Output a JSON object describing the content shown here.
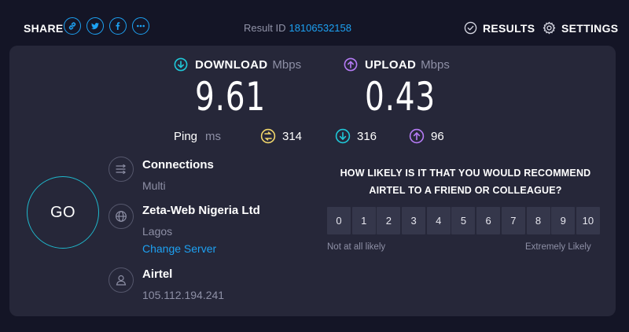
{
  "header": {
    "share_label": "SHARE",
    "share_buttons": [
      {
        "icon": "link-icon",
        "color": "#1da1f2"
      },
      {
        "icon": "twitter-icon",
        "color": "#1da1f2"
      },
      {
        "icon": "facebook-icon",
        "color": "#1da1f2"
      },
      {
        "icon": "more-icon",
        "color": "#1da1f2"
      }
    ],
    "result_id_label": "Result ID",
    "result_id": "18106532158",
    "results_label": "RESULTS",
    "settings_label": "SETTINGS"
  },
  "speeds": {
    "download": {
      "label": "DOWNLOAD",
      "unit": "Mbps",
      "value": "9.61",
      "color": "#1fc8d8"
    },
    "upload": {
      "label": "UPLOAD",
      "unit": "Mbps",
      "value": "0.43",
      "color": "#b57bf5"
    }
  },
  "ping": {
    "label": "Ping",
    "unit": "ms",
    "jitter_value": "314",
    "download_value": "316",
    "upload_value": "96"
  },
  "go_label": "GO",
  "connections": {
    "title": "Connections",
    "value": "Multi"
  },
  "server": {
    "name": "Zeta-Web Nigeria Ltd",
    "location": "Lagos",
    "change_label": "Change Server"
  },
  "provider": {
    "name": "Airtel",
    "ip": "105.112.194.241"
  },
  "survey": {
    "question_line1": "HOW LIKELY IS IT THAT YOU WOULD RECOMMEND",
    "question_line2": "AIRTEL TO A FRIEND OR COLLEAGUE?",
    "scale": [
      "0",
      "1",
      "2",
      "3",
      "4",
      "5",
      "6",
      "7",
      "8",
      "9",
      "10"
    ],
    "low_label": "Not at all likely",
    "high_label": "Extremely Likely"
  }
}
